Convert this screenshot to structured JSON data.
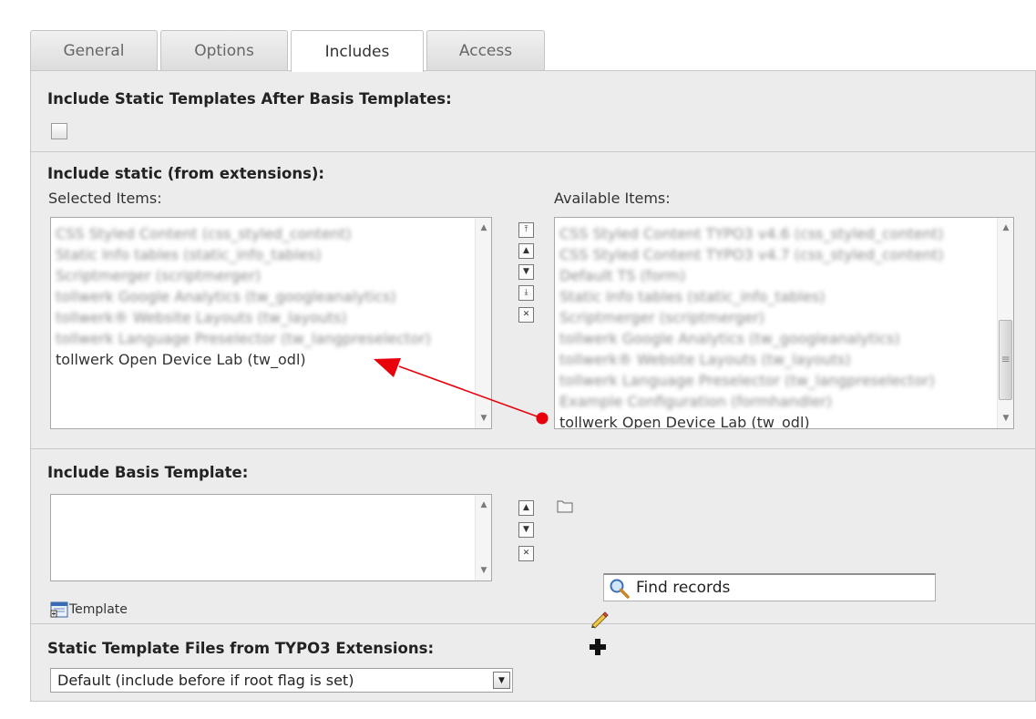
{
  "tabs": [
    {
      "label": "General"
    },
    {
      "label": "Options"
    },
    {
      "label": "Includes",
      "active": true
    },
    {
      "label": "Access"
    }
  ],
  "static_after_basis": {
    "heading": "Include Static Templates After Basis Templates:",
    "checked": false
  },
  "include_static": {
    "heading": "Include static (from extensions):",
    "selected_label": "Selected Items:",
    "available_label": "Available Items:",
    "selected_items": [
      "CSS Styled Content (css_styled_content)",
      "Static Info tables (static_info_tables)",
      "Scriptmerger (scriptmerger)",
      "tollwerk Google Analytics (tw_googleanalytics)",
      "tollwerk® Website Layouts (tw_layouts)",
      "tollwerk Language Preselector (tw_langpreselector)",
      "tollwerk Open Device Lab (tw_odl)"
    ],
    "available_items": [
      "CSS Styled Content TYPO3 v4.6 (css_styled_content)",
      "CSS Styled Content TYPO3 v4.7 (css_styled_content)",
      "Default TS (form)",
      "Static Info tables (static_info_tables)",
      "Scriptmerger (scriptmerger)",
      "tollwerk Google Analytics (tw_googleanalytics)",
      "tollwerk® Website Layouts (tw_layouts)",
      "tollwerk Language Preselector (tw_langpreselector)",
      "Example Configuration (formhandler)",
      "tollwerk Open Device Lab (tw_odl)"
    ],
    "annotation_color": "#e8000b"
  },
  "basis_template": {
    "heading": "Include Basis Template:",
    "search_placeholder": "Find records",
    "template_link": "Template"
  },
  "static_files": {
    "heading": "Static Template Files from TYPO3 Extensions:",
    "selected": "Default (include before if root flag is set)"
  }
}
